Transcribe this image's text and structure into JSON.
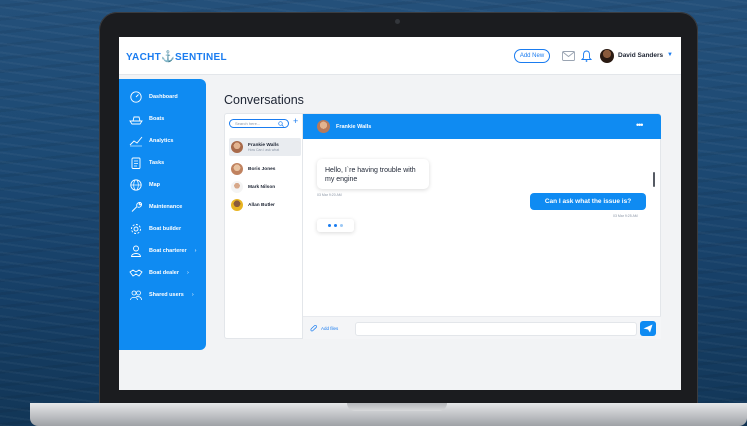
{
  "brand": {
    "logo_left": "YACHT",
    "logo_right": "SENTINEL",
    "accent": "#0f8bf2"
  },
  "topbar": {
    "add_new_label": "Add New",
    "user_name": "David Sanders"
  },
  "sidebar": {
    "items": [
      {
        "label": "Dashboard",
        "icon": "gauge-icon"
      },
      {
        "label": "Boats",
        "icon": "boat-icon"
      },
      {
        "label": "Analytics",
        "icon": "analytics-icon"
      },
      {
        "label": "Tasks",
        "icon": "clipboard-icon"
      },
      {
        "label": "Map",
        "icon": "globe-icon"
      },
      {
        "label": "Maintenance",
        "icon": "wrench-icon"
      },
      {
        "label": "Boat builder",
        "icon": "gear-icon"
      },
      {
        "label": "Boat charterer",
        "icon": "user-icon",
        "chevron": "›"
      },
      {
        "label": "Boat dealer",
        "icon": "handshake-icon",
        "chevron": "›"
      },
      {
        "label": "Shared users",
        "icon": "users-icon",
        "chevron": "›"
      }
    ]
  },
  "page": {
    "title": "Conversations"
  },
  "conversations": {
    "search_placeholder": "Search here...",
    "contacts": [
      {
        "name": "Frankie Walls",
        "preview": "How Can I ask what",
        "active": true
      },
      {
        "name": "Boris Jones",
        "preview": "",
        "active": false
      },
      {
        "name": "Mark Nilson",
        "preview": "",
        "active": false
      },
      {
        "name": "Allan Butler",
        "preview": "",
        "active": false
      }
    ]
  },
  "chat": {
    "contact_name": "Frankie Walls",
    "messages": [
      {
        "direction": "in",
        "text": "Hello, I`re having trouble with my engine",
        "time": "03 Mar 9:20 AM"
      },
      {
        "direction": "out",
        "text": "Can I ask what the issue is?",
        "time": "03 Mar 9:25 AM"
      }
    ],
    "add_files_label": "Add files"
  }
}
